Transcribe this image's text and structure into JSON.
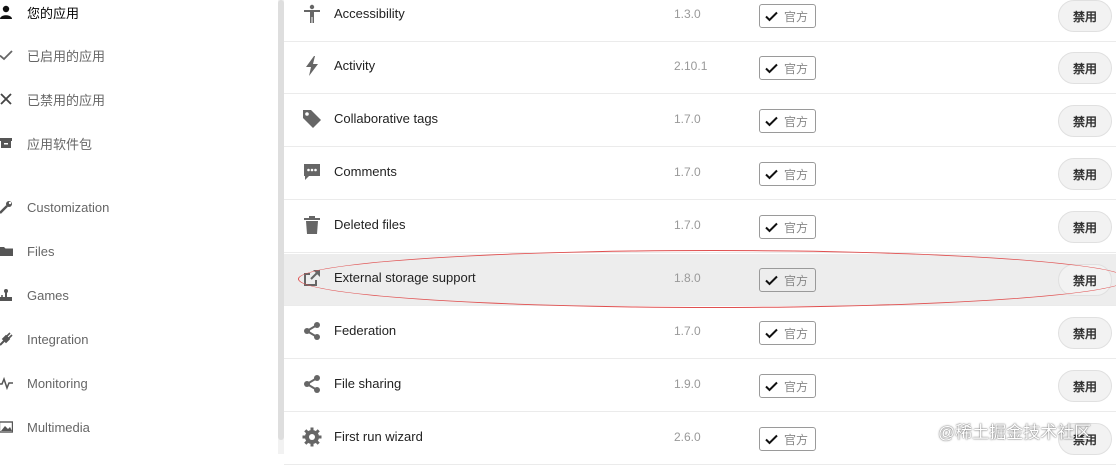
{
  "sidebar": {
    "items": [
      {
        "label": "您的应用",
        "icon": "user-icon",
        "active": true
      },
      {
        "label": "已启用的应用",
        "icon": "checkmark-icon"
      },
      {
        "label": "已禁用的应用",
        "icon": "close-icon"
      },
      {
        "label": "应用软件包",
        "icon": "package-icon"
      }
    ],
    "categories": [
      {
        "label": "Customization",
        "icon": "wrench-icon"
      },
      {
        "label": "Files",
        "icon": "folder-icon"
      },
      {
        "label": "Games",
        "icon": "joystick-icon"
      },
      {
        "label": "Integration",
        "icon": "plug-icon"
      },
      {
        "label": "Monitoring",
        "icon": "pulse-icon"
      },
      {
        "label": "Multimedia",
        "icon": "image-icon"
      }
    ]
  },
  "apps": [
    {
      "name": "Accessibility",
      "version": "1.3.0",
      "badge": "官方",
      "action": "禁用",
      "icon": "accessibility-icon"
    },
    {
      "name": "Activity",
      "version": "2.10.1",
      "badge": "官方",
      "action": "禁用",
      "icon": "lightning-icon"
    },
    {
      "name": "Collaborative tags",
      "version": "1.7.0",
      "badge": "官方",
      "action": "禁用",
      "icon": "tag-icon"
    },
    {
      "name": "Comments",
      "version": "1.7.0",
      "badge": "官方",
      "action": "禁用",
      "icon": "comment-icon"
    },
    {
      "name": "Deleted files",
      "version": "1.7.0",
      "badge": "官方",
      "action": "禁用",
      "icon": "trash-icon"
    },
    {
      "name": "External storage support",
      "version": "1.8.0",
      "badge": "官方",
      "action": "禁用",
      "icon": "external-link-icon",
      "highlighted": true
    },
    {
      "name": "Federation",
      "version": "1.7.0",
      "badge": "官方",
      "action": "禁用",
      "icon": "share-icon"
    },
    {
      "name": "File sharing",
      "version": "1.9.0",
      "badge": "官方",
      "action": "禁用",
      "icon": "share-icon"
    },
    {
      "name": "First run wizard",
      "version": "2.6.0",
      "badge": "官方",
      "action": "禁用",
      "icon": "gear-icon"
    }
  ],
  "watermark": "@稀土掘金技术社区",
  "colors": {
    "highlight_row": "#ededed",
    "annotation_ellipse": "#e05050",
    "icon_gray": "#777777"
  }
}
